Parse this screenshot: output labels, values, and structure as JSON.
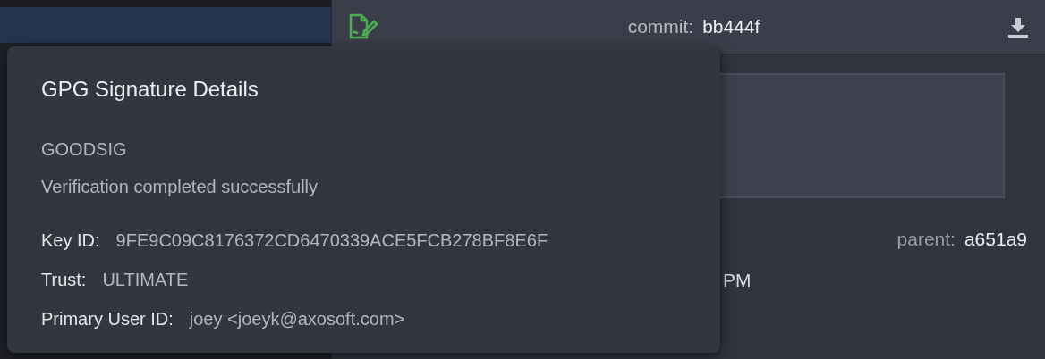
{
  "header": {
    "commit_label": "commit:",
    "commit_value": "bb444f"
  },
  "parent": {
    "label": "parent:",
    "value": "a651a9"
  },
  "date_fragment": "PM",
  "popover": {
    "title": "GPG Signature Details",
    "status": "GOODSIG",
    "message": "Verification completed successfully",
    "fields": [
      {
        "label": "Key ID:",
        "value": "9FE9C09C8176372CD6470339ACE5FCB278BF8E6F"
      },
      {
        "label": "Trust:",
        "value": "ULTIMATE"
      },
      {
        "label": "Primary User ID:",
        "value": "joey <joeyk@axosoft.com>"
      }
    ]
  }
}
